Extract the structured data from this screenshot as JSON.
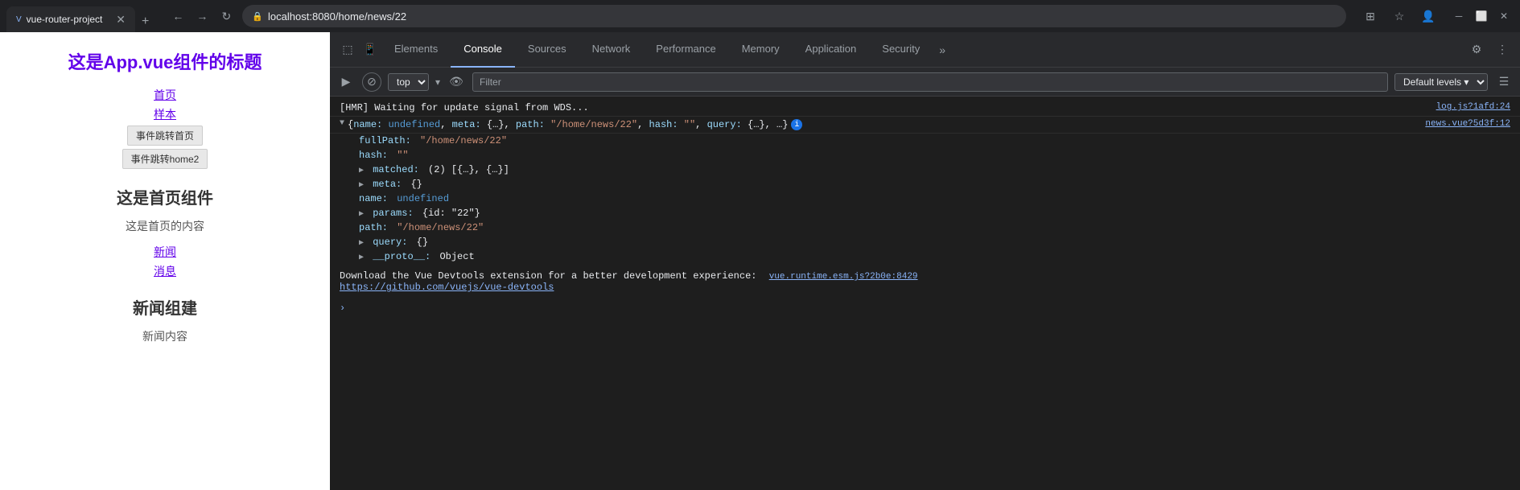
{
  "browser": {
    "tab_title": "vue-router-project",
    "tab_favicon": "V",
    "address": "localhost:8080/home/news/22",
    "new_tab_label": "+",
    "back_label": "←",
    "forward_label": "→",
    "refresh_label": "↻"
  },
  "page": {
    "app_title": "这是App.vue组件的标题",
    "nav": {
      "home_link": "首页",
      "sample_link": "样本",
      "btn_home": "事件跳转首页",
      "btn_home2": "事件跳转home2"
    },
    "home_section": {
      "title": "这是首页组件",
      "content": "这是首页的内容",
      "news_link": "新闻",
      "messages_link": "消息"
    },
    "news_section": {
      "title": "新闻组建",
      "content": "新闻内容"
    }
  },
  "devtools": {
    "tabs": [
      {
        "label": "Elements",
        "active": false
      },
      {
        "label": "Console",
        "active": true
      },
      {
        "label": "Sources",
        "active": false
      },
      {
        "label": "Network",
        "active": false
      },
      {
        "label": "Performance",
        "active": false
      },
      {
        "label": "Memory",
        "active": false
      },
      {
        "label": "Application",
        "active": false
      },
      {
        "label": "Security",
        "active": false
      },
      {
        "label": "»",
        "active": false
      }
    ],
    "console": {
      "context": "top",
      "filter_placeholder": "Filter",
      "levels": "Default levels ▾",
      "hmr_message": "[HMR] Waiting for update signal from WDS...",
      "hmr_source": "log.js?1afd:24",
      "object_line": "{name: undefined, meta: {...}, path: \"/home/news/22\", hash: \"\", query: {...}, …}",
      "object_source": "news.vue?5d3f:12",
      "full_path_label": "fullPath:",
      "full_path_value": "\"/home/news/22\"",
      "hash_label": "hash:",
      "hash_value": "\"\"",
      "matched_label": "matched:",
      "matched_value": "(2) [{…}, {…}]",
      "meta_label": "meta:",
      "meta_value": "{}",
      "name_label": "name:",
      "name_value": "undefined",
      "params_label": "params:",
      "params_value": "{id: \"22\"}",
      "path_label": "path:",
      "path_value": "\"/home/news/22\"",
      "query_label": "query:",
      "query_value": "{}",
      "proto_label": "__proto__:",
      "proto_value": "Object",
      "download_text": "Download the Vue Devtools extension for a better development experience:",
      "download_link": "https://github.com/vuejs/vue-devtools",
      "download_source": "vue.runtime.esm.js?2b0e:8429"
    }
  }
}
